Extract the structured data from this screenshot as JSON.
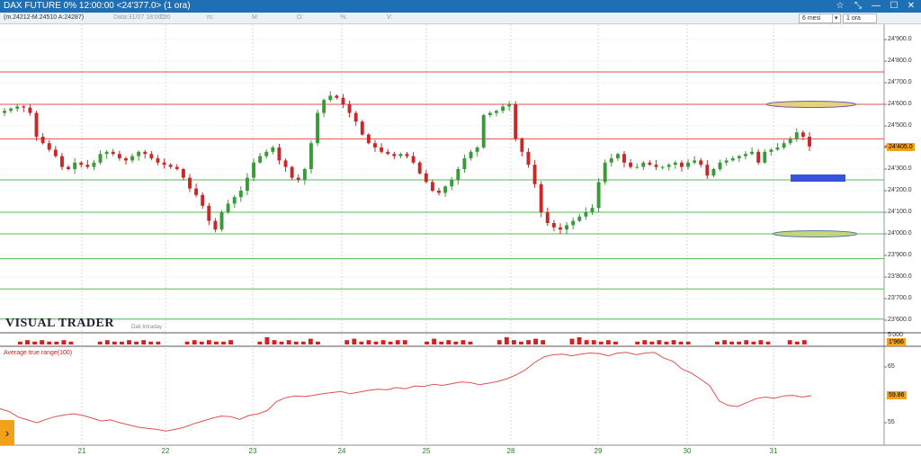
{
  "window": {
    "title": "DAX FUTURE 0% 12:00:00  <24'377.0> (1 ora)",
    "buttons": [
      "☆",
      "⤡",
      "—",
      "☐",
      "✕"
    ]
  },
  "toolbar": {
    "info": "(m.24212-M.24510 A:24287)",
    "data_label": "Data:31/07 18:00:00",
    "c_label": "C:",
    "m_label": "m:",
    "M_label": "M:",
    "O_label": "O:",
    "pct_label": "%:",
    "V_label": "V:",
    "period_select": "6 mesi",
    "interval_select": "1 ora"
  },
  "price_axis": {
    "labels": [
      "24'900.0",
      "24'800.0",
      "24'700.0",
      "24'600.0",
      "24'500.0",
      "24'400.0",
      "24'300.0",
      "24'200.0",
      "24'100.0",
      "24'000.0",
      "23'900.0",
      "23'800.0",
      "23'700.0",
      "23'600.0"
    ],
    "current_price": "24'405.0"
  },
  "volume_panel": {
    "top_label": "5'000",
    "current_value": "1'966"
  },
  "atr_panel": {
    "title": "Average true range(100)",
    "labels": [
      "65",
      "55"
    ],
    "current_value": "59.86"
  },
  "logo": {
    "text": "VISUAL TRADER",
    "subtitle": "Dati Intraday"
  },
  "x_axis": {
    "labels": [
      "21",
      "22",
      "23",
      "24",
      "25",
      "28",
      "29",
      "30",
      "31"
    ]
  },
  "colors": {
    "up": "#3a9a3a",
    "down": "#c82828",
    "resistance": "#e05050",
    "support": "#55bb55",
    "atr_line": "#e05050",
    "accent": "#f2a11a"
  },
  "chart_data": {
    "type": "candlestick",
    "x": [
      "21",
      "22",
      "23",
      "24",
      "25",
      "28",
      "29",
      "30",
      "31"
    ],
    "ylim": [
      23600,
      24950
    ],
    "ylabel_ticks": [
      24900,
      24800,
      24700,
      24600,
      24500,
      24400,
      24300,
      24200,
      24100,
      24000,
      23900,
      23800,
      23700,
      23600
    ],
    "resistance_levels": [
      24750,
      24600,
      24440
    ],
    "support_levels": [
      24250,
      24100,
      24000,
      23885,
      23745,
      23605
    ],
    "close_path": [
      24570,
      24580,
      24590,
      24585,
      24560,
      24450,
      24420,
      24390,
      24360,
      24310,
      24300,
      24330,
      24320,
      24310,
      24330,
      24370,
      24380,
      24370,
      24350,
      24340,
      24360,
      24380,
      24370,
      24350,
      24330,
      24320,
      24310,
      24300,
      24260,
      24210,
      24180,
      24130,
      24060,
      24020,
      24100,
      24140,
      24170,
      24200,
      24260,
      24330,
      24360,
      24380,
      24400,
      24340,
      24310,
      24260,
      24250,
      24300,
      24420,
      24560,
      24620,
      24640,
      24630,
      24600,
      24560,
      24520,
      24460,
      24420,
      24400,
      24380,
      24370,
      24360,
      24370,
      24360,
      24330,
      24280,
      24240,
      24200,
      24190,
      24220,
      24250,
      24300,
      24350,
      24380,
      24400,
      24550,
      24560,
      24570,
      24590,
      24600,
      24440,
      24380,
      24320,
      24230,
      24100,
      24050,
      24030,
      24020,
      24040,
      24060,
      24080,
      24100,
      24120,
      24240,
      24330,
      24350,
      24370,
      24330,
      24310,
      24310,
      24330,
      24320,
      24310,
      24310,
      24320,
      24330,
      24310,
      24330,
      24340,
      24320,
      24270,
      24300,
      24330,
      24340,
      24350,
      24360,
      24370,
      24380,
      24330,
      24380,
      24390,
      24400,
      24420,
      24440,
      24470,
      24450,
      24405
    ],
    "atr_values": [
      57.5,
      57.0,
      56.0,
      55.5,
      55.0,
      55.6,
      56.1,
      56.4,
      56.6,
      56.3,
      55.8,
      55.3,
      55.5,
      55.0,
      54.6,
      54.2,
      54.0,
      53.8,
      53.5,
      53.8,
      54.2,
      54.8,
      55.3,
      55.8,
      56.2,
      56.1,
      55.6,
      56.3,
      56.6,
      57.2,
      58.8,
      59.5,
      59.8,
      59.7,
      59.9,
      60.2,
      60.4,
      60.6,
      60.2,
      60.5,
      60.8,
      61.0,
      60.9,
      61.3,
      61.1,
      61.6,
      61.5,
      61.9,
      61.7,
      62.0,
      62.3,
      62.2,
      61.8,
      62.1,
      62.4,
      62.9,
      63.6,
      64.5,
      65.8,
      66.8,
      67.2,
      67.3,
      67.0,
      67.3,
      67.5,
      67.4,
      67.0,
      67.5,
      67.6,
      67.2,
      67.5,
      67.6,
      66.6,
      66.0,
      64.6,
      63.9,
      62.8,
      61.6,
      58.9,
      58.1,
      57.9,
      58.6,
      59.3,
      59.6,
      59.4,
      59.8,
      59.9,
      59.6,
      59.86
    ],
    "volume_bars": [
      2,
      3,
      2,
      3,
      2,
      2,
      3,
      2,
      0,
      0,
      0,
      2,
      3,
      2,
      2,
      3,
      2,
      3,
      2,
      2,
      0,
      0,
      0,
      2,
      3,
      2,
      3,
      2,
      2,
      3,
      0,
      0,
      0,
      2,
      5,
      3,
      2,
      3,
      2,
      2,
      4,
      2,
      0,
      0,
      0,
      3,
      4,
      2,
      3,
      2,
      3,
      2,
      3,
      3,
      0,
      0,
      2,
      4,
      2,
      3,
      2,
      3,
      2,
      0,
      0,
      0,
      3,
      5,
      3,
      2,
      3,
      4,
      3,
      0,
      0,
      0,
      4,
      5,
      3,
      3,
      2,
      3,
      2,
      0,
      0,
      2,
      3,
      2,
      3,
      2,
      3,
      2,
      2,
      0,
      0,
      0,
      2,
      3,
      2,
      2,
      3,
      2,
      3,
      2,
      0,
      0,
      3,
      2,
      3
    ]
  }
}
